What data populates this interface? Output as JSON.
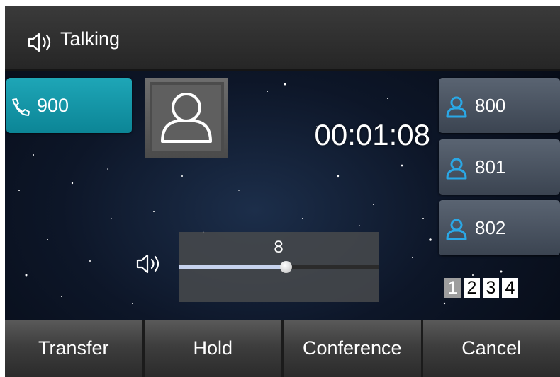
{
  "status_bar": {
    "icon": "speaker-icon",
    "text": "Talking"
  },
  "active_line": {
    "icon": "phone-handset-icon",
    "number": "900"
  },
  "caller_avatar": {
    "icon": "person-icon"
  },
  "call_timer": "00:01:08",
  "contacts": [
    {
      "icon": "person-icon",
      "number": "800"
    },
    {
      "icon": "person-icon",
      "number": "801"
    },
    {
      "icon": "person-icon",
      "number": "802"
    }
  ],
  "volume": {
    "icon": "speaker-icon",
    "value": "8",
    "max": 15
  },
  "pages": [
    {
      "label": "1",
      "active": true
    },
    {
      "label": "2",
      "active": false
    },
    {
      "label": "3",
      "active": false
    },
    {
      "label": "4",
      "active": false
    }
  ],
  "softkeys": [
    "Transfer",
    "Hold",
    "Conference",
    "Cancel"
  ],
  "colors": {
    "active_line": "#1599aa",
    "contact_icon": "#2aa8e6",
    "volume_fill": "#c7d3ee"
  }
}
